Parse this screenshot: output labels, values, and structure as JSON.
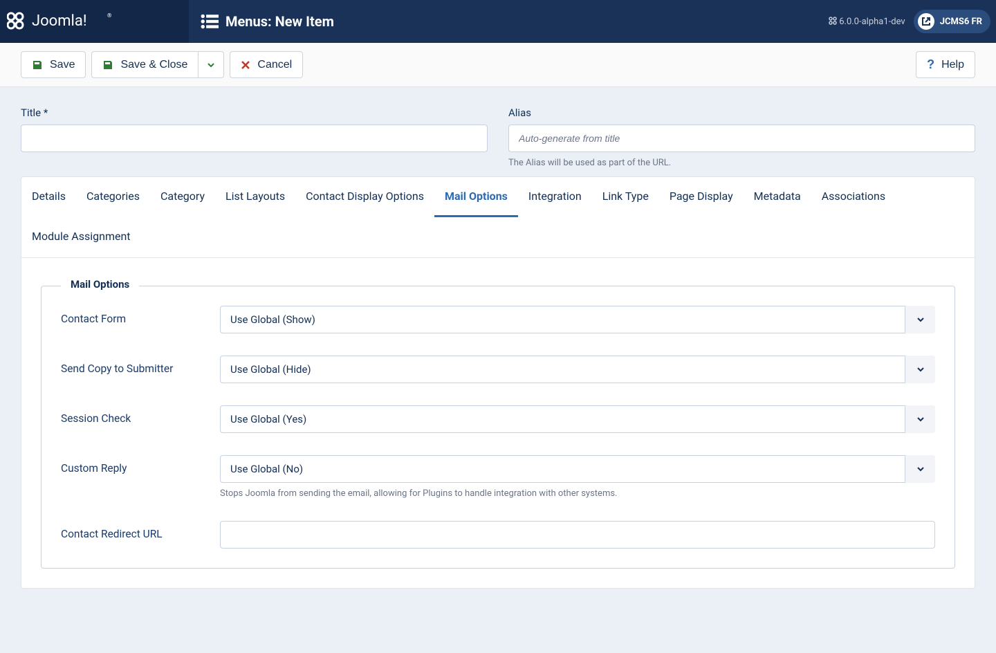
{
  "header": {
    "page_title": "Menus: New Item",
    "version": "6.0.0-alpha1-dev",
    "site_name": "JCMS6 FR"
  },
  "toolbar": {
    "save": "Save",
    "save_close": "Save & Close",
    "cancel": "Cancel",
    "help": "Help"
  },
  "form": {
    "title_label": "Title *",
    "title_value": "",
    "alias_label": "Alias",
    "alias_placeholder": "Auto-generate from title",
    "alias_help": "The Alias will be used as part of the URL."
  },
  "tabs": [
    "Details",
    "Categories",
    "Category",
    "List Layouts",
    "Contact Display Options",
    "Mail Options",
    "Integration",
    "Link Type",
    "Page Display",
    "Metadata",
    "Associations",
    "Module Assignment"
  ],
  "active_tab": "Mail Options",
  "fieldset": {
    "legend": "Mail Options",
    "fields": [
      {
        "label": "Contact Form",
        "value": "Use Global (Show)",
        "type": "select"
      },
      {
        "label": "Send Copy to Submitter",
        "value": "Use Global (Hide)",
        "type": "select"
      },
      {
        "label": "Session Check",
        "value": "Use Global (Yes)",
        "type": "select"
      },
      {
        "label": "Custom Reply",
        "value": "Use Global (No)",
        "type": "select",
        "desc": "Stops Joomla from sending the email, allowing for Plugins to handle integration with other systems."
      },
      {
        "label": "Contact Redirect URL",
        "value": "",
        "type": "text"
      }
    ]
  }
}
